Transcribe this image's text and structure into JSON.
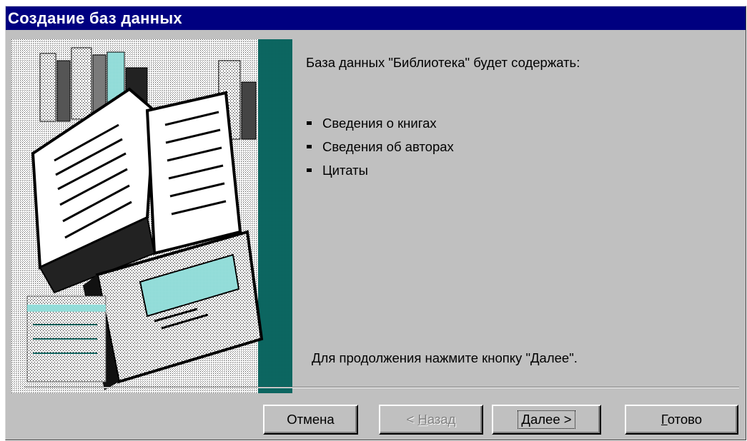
{
  "window": {
    "title": "Создание баз данных"
  },
  "content": {
    "intro": "База данных \"Библиотека\" будет содержать:",
    "bullets": [
      "Сведения о книгах",
      "Сведения об авторах",
      "Цитаты"
    ],
    "continue_hint": "Для продолжения нажмите кнопку \"Далее\"."
  },
  "buttons": {
    "cancel": "Отмена",
    "back": {
      "prefix": "< ",
      "hotkey": "Н",
      "rest": "азад"
    },
    "next": {
      "hotkey": "Д",
      "rest": "алее >"
    },
    "finish": {
      "hotkey": "Г",
      "rest": "отово"
    }
  },
  "illustration": {
    "icon": "books-illustration"
  },
  "colors": {
    "titlebar": "#000080",
    "dialog": "#c0c0c0",
    "accent": "#0b5f5a"
  }
}
